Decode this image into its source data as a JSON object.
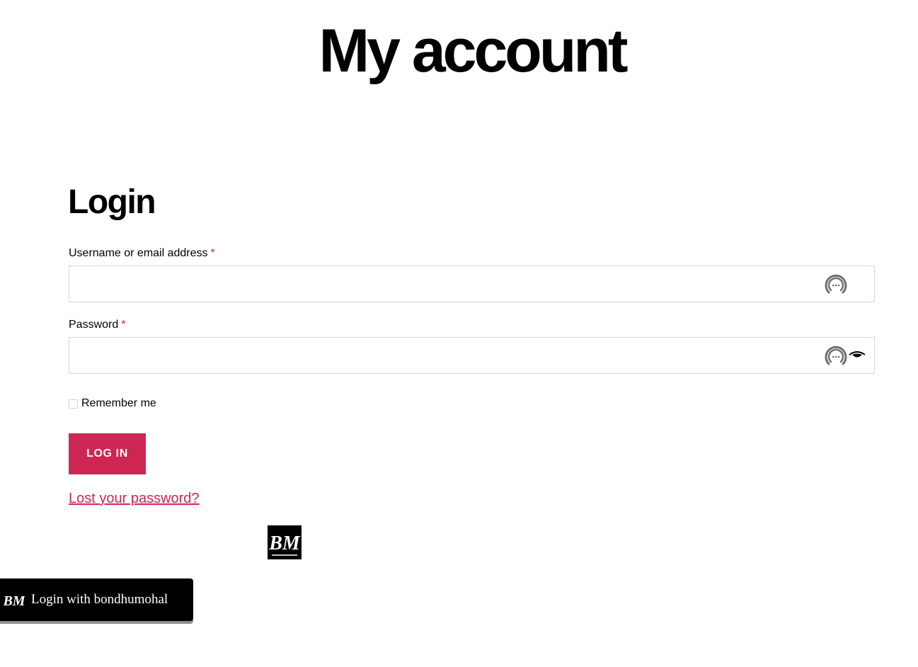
{
  "page": {
    "title": "My account"
  },
  "login": {
    "heading": "Login",
    "username_label": "Username or email address",
    "password_label": "Password",
    "required_mark": "*",
    "username_value": "",
    "password_value": "",
    "remember_label": "Remember me",
    "remember_checked": false,
    "submit_label": "LOG IN",
    "lost_password_label": "Lost your password?",
    "password_manager_icon": "password-manager-icon",
    "show_password_icon": "eye-icon"
  },
  "social": {
    "logo_text": "BM",
    "button_label": "Login with bondhumohal"
  },
  "colors": {
    "accent": "#cd2653",
    "field_border": "#dcd7ca",
    "social_bg": "#000000"
  }
}
